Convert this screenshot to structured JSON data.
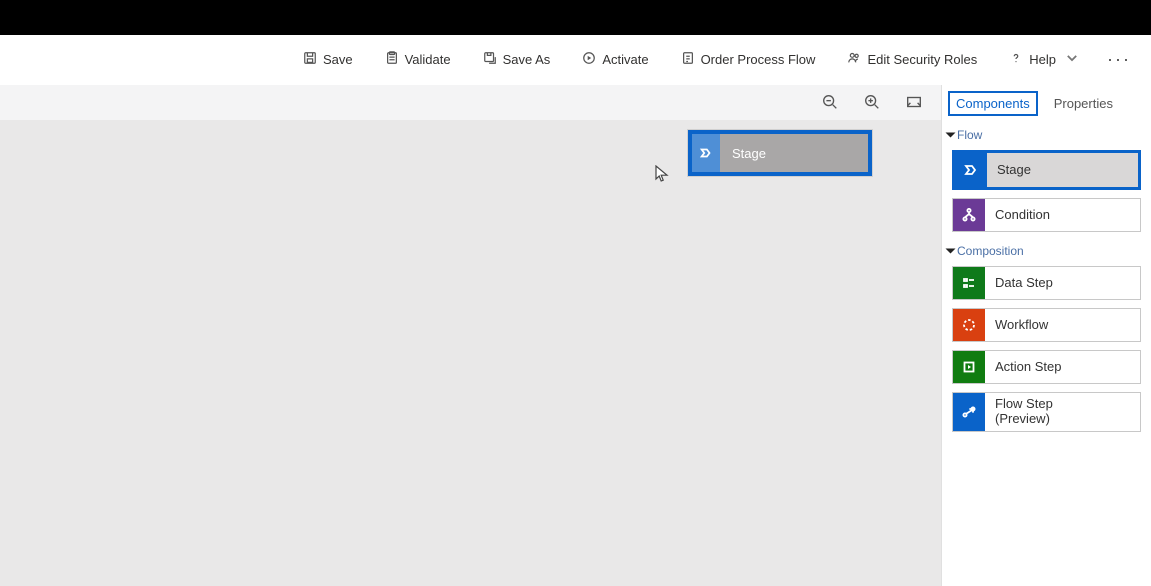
{
  "toolbar": {
    "save": "Save",
    "validate": "Validate",
    "save_as": "Save As",
    "activate": "Activate",
    "order": "Order Process Flow",
    "edit_roles": "Edit Security Roles",
    "help": "Help"
  },
  "drag_tile": {
    "label": "Stage"
  },
  "right_panel": {
    "tabs": {
      "components": "Components",
      "properties": "Properties"
    },
    "sections": {
      "flow": "Flow",
      "composition": "Composition"
    },
    "items": {
      "stage": "Stage",
      "condition": "Condition",
      "data_step": "Data Step",
      "workflow": "Workflow",
      "action_step": "Action Step",
      "flow_step": "Flow Step\n(Preview)"
    }
  }
}
